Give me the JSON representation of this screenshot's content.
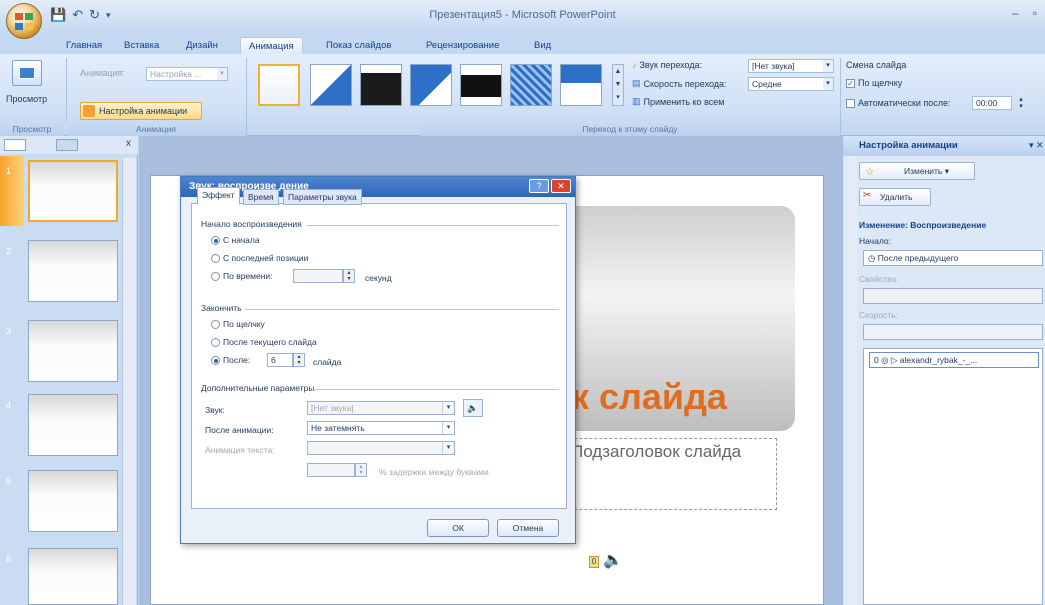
{
  "window": {
    "title": "Презентация5 - Microsoft PowerPoint",
    "controls": [
      "–",
      "▫",
      "✕"
    ]
  },
  "tabs": [
    "Главная",
    "Вставка",
    "Дизайн",
    "Анимация",
    "Показ слайдов",
    "Рецензирование",
    "Вид"
  ],
  "active_tab": "Анимация",
  "ribbon": {
    "preview_label": "Просмотр",
    "preview_group": "Просмотр",
    "animation_label": "Анимация:",
    "animation_value": "Настройка ...",
    "custom_animation_label": "Настройка анимации",
    "animation_group": "Анимация",
    "transition_sound_label": "Звук перехода:",
    "transition_sound_value": "[Нет звука]",
    "transition_speed_label": "Скорость перехода:",
    "transition_speed_value": "Средне",
    "apply_all_label": "Применить ко всем",
    "transition_group": "Переход к этому слайду",
    "advance_slide_label": "Смена слайда",
    "on_click_label": "По щелчку",
    "auto_after_label": "Автоматически после:",
    "auto_after_value": "00:00"
  },
  "slides_panel": {
    "close": "x",
    "slide_numbers": [
      "1",
      "2",
      "3",
      "4",
      "5",
      "6"
    ]
  },
  "slide": {
    "title_fragment": "к слайда",
    "subtitle_fragment": "Подзаголовок слайда",
    "marker": "0"
  },
  "dialog": {
    "title": "Звук: воспроизве дение",
    "tabs": [
      "Эффект",
      "Время",
      "Параметры звука"
    ],
    "start_group": "Начало воспроизведения",
    "start_from_beginning": "С начала",
    "start_last_position": "С последней позиции",
    "start_by_time": "По времени:",
    "seconds_label": "секунд",
    "end_group": "Закончить",
    "end_on_click": "По щелчку",
    "end_after_current": "После текущего слайда",
    "end_after": "После:",
    "end_after_value": "6",
    "slides_label": "слайда",
    "extra_group": "Дополнительные параметры",
    "sound_label": "Звук:",
    "sound_value": "[Нет звука]",
    "after_anim_label": "После анимации:",
    "after_anim_value": "Не затемнять",
    "anim_text_label": "Анимация текста:",
    "delay_label": "% задержка между буквами",
    "ok": "ОК",
    "cancel": "Отмена"
  },
  "task_pane": {
    "title": "Настройка анимации",
    "change_btn": "Изменить",
    "remove_btn": "Удалить",
    "change_header": "Изменение: Воспроизведение",
    "start_label": "Начало:",
    "start_value": "После предыдущего",
    "property_label": "Свойство:",
    "speed_label": "Скорость:",
    "list_item": "0 ◎  ▷ alexandr_rybak_-_..."
  }
}
